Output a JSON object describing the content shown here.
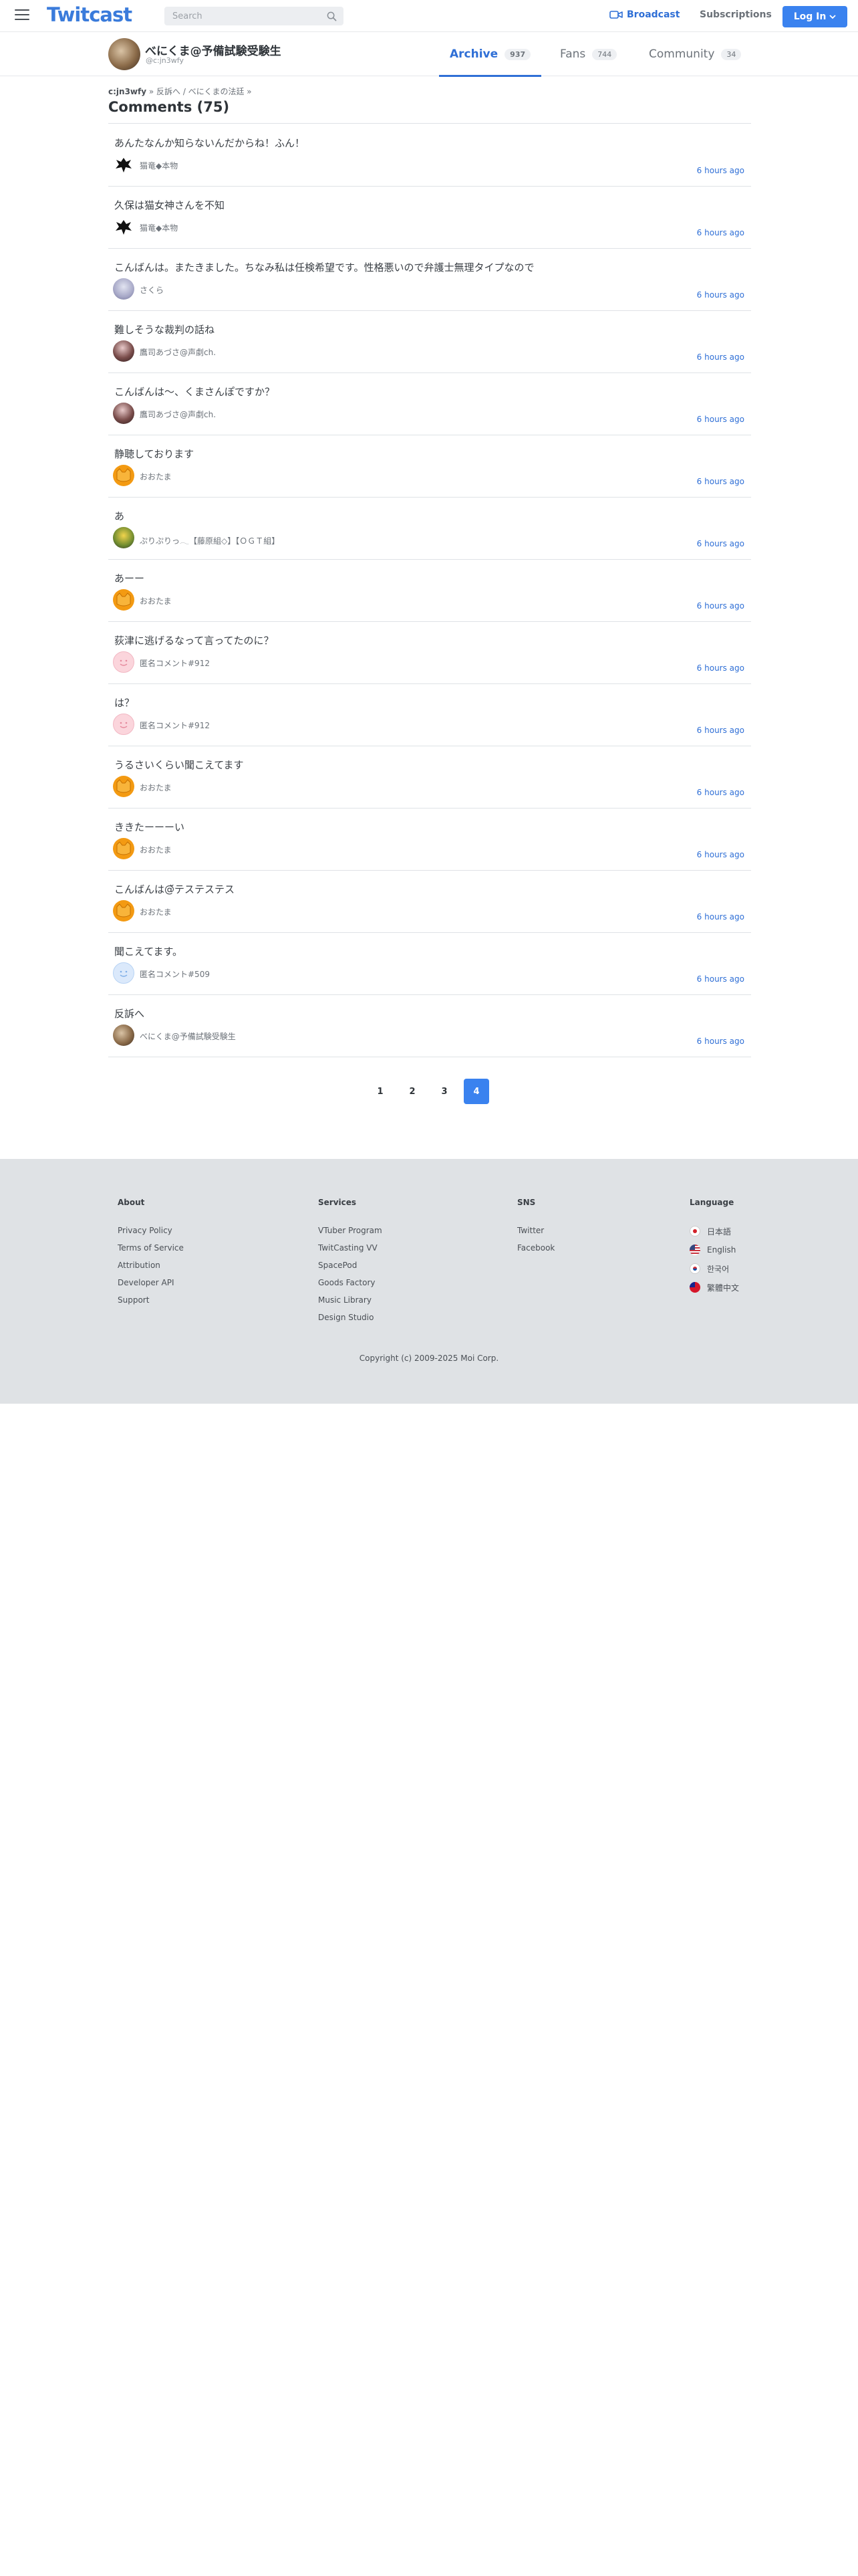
{
  "header": {
    "logo": "Twitcast",
    "search_placeholder": "Search",
    "broadcast_label": "Broadcast",
    "subscriptions_label": "Subscriptions",
    "login_label": "Log In"
  },
  "profile": {
    "name": "べにくま@予備試験受験生",
    "handle": "@c:jn3wfy",
    "tabs": [
      {
        "label": "Archive",
        "count": "937"
      },
      {
        "label": "Fans",
        "count": "744"
      },
      {
        "label": "Community",
        "count": "34"
      }
    ]
  },
  "breadcrumb": {
    "user": "c:jn3wfy",
    "sep1": " » ",
    "path": "反訴へ / べにくまの法廷",
    "sep2": " »"
  },
  "page_title": "Comments (75)",
  "comments": [
    {
      "text": "あんたなんか知らないんだからね！ふん！",
      "user": "猫竜◆本物",
      "time": "6 hours ago"
    },
    {
      "text": "久保は猫女神さんを不知",
      "user": "猫竜◆本物",
      "time": "6 hours ago"
    },
    {
      "text": "こんばんは。またきました。ちなみ私は任検希望です。性格悪いので弁護士無理タイプなので",
      "user": "さくら",
      "time": "6 hours ago"
    },
    {
      "text": "難しそうな裁判の話ね",
      "user": "鷹司あづさ@声劇ch.",
      "time": "6 hours ago"
    },
    {
      "text": "こんばんは〜、くまさんぽですか？",
      "user": "鷹司あづさ@声劇ch.",
      "time": "6 hours ago"
    },
    {
      "text": "静聴しております",
      "user": "おおたま",
      "time": "6 hours ago"
    },
    {
      "text": "あ",
      "user": "ぷりぷりっ𓂃【藤原組◇】【ＯＧＴ組】",
      "time": "6 hours ago"
    },
    {
      "text": "あーー",
      "user": "おおたま",
      "time": "6 hours ago"
    },
    {
      "text": "荻津に逃げるなって言ってたのに？",
      "user": "匿名コメント#912",
      "time": "6 hours ago"
    },
    {
      "text": "は？",
      "user": "匿名コメント#912",
      "time": "6 hours ago"
    },
    {
      "text": "うるさいくらい聞こえてます",
      "user": "おおたま",
      "time": "6 hours ago"
    },
    {
      "text": "ききたーーーい",
      "user": "おおたま",
      "time": "6 hours ago"
    },
    {
      "text": "こんばんは@̆テステステス",
      "user": "おおたま",
      "time": "6 hours ago"
    },
    {
      "text": "聞こえてます。",
      "user": "匿名コメント#509",
      "time": "6 hours ago"
    },
    {
      "text": "反訴へ",
      "user": "べにくま@予備試験受験生",
      "time": "6 hours ago"
    }
  ],
  "pagination": [
    "1",
    "2",
    "3",
    "4"
  ],
  "pagination_active": "4",
  "footer": {
    "about": {
      "title": "About",
      "links": [
        "Privacy Policy",
        "Terms of Service",
        "Attribution",
        "Developer API",
        "Support"
      ]
    },
    "services": {
      "title": "Services",
      "links": [
        "VTuber Program",
        "TwitCasting VV",
        "SpacePod",
        "Goods Factory",
        "Music Library",
        "Design Studio"
      ]
    },
    "sns": {
      "title": "SNS",
      "links": [
        "Twitter",
        "Facebook"
      ]
    },
    "language": {
      "title": "Language",
      "links": [
        "日本語",
        "English",
        "한국어",
        "繁體中文"
      ]
    },
    "copyright": "Copyright (c) 2009-2025 Moi Corp."
  },
  "colors": {
    "accent": "#3a82ef",
    "link": "#2f6fd6",
    "footer_bg": "#dfe2e5"
  },
  "icons": [
    "hamburger-icon",
    "search-icon",
    "video-camera-icon",
    "chevron-down-icon"
  ]
}
